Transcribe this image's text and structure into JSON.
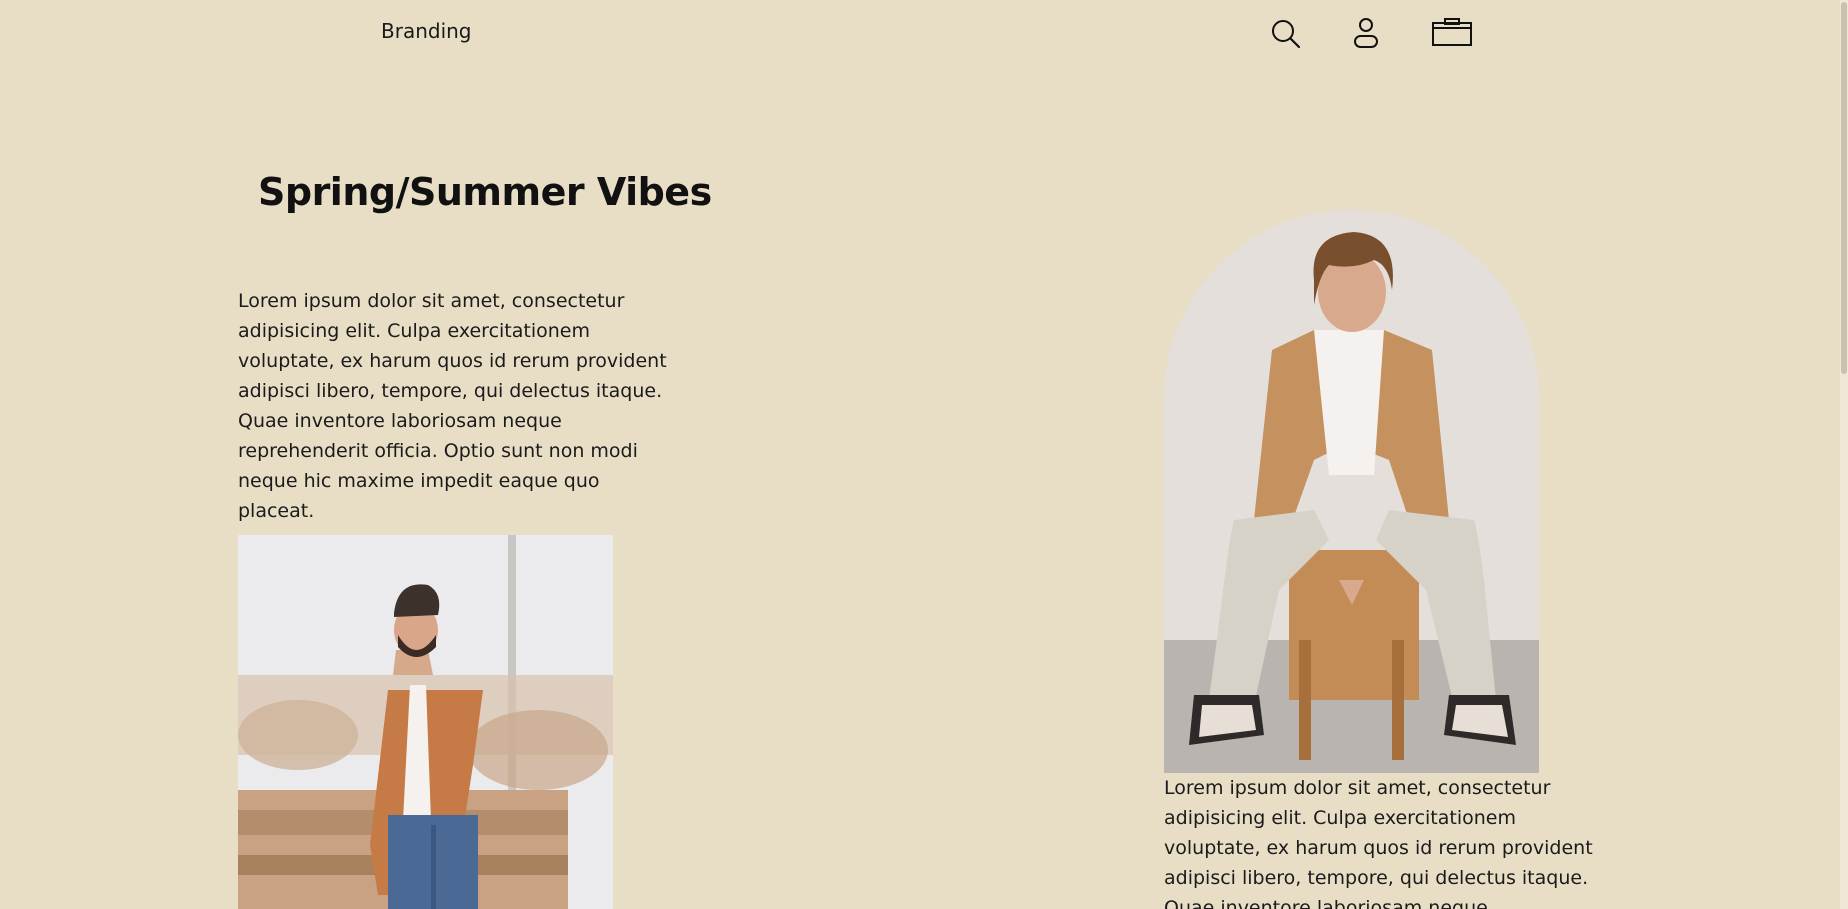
{
  "header": {
    "brand": "Branding",
    "icons": [
      "search-icon",
      "user-icon",
      "cart-icon"
    ]
  },
  "hero": {
    "title": "Spring/Summer Vibes",
    "paragraph_left": "Lorem ipsum dolor sit amet, consectetur adipisicing elit. Culpa exercitationem voluptate, ex harum quos id rerum provident adipisci libero, tempore, qui delectus itaque. Quae inventore laboriosam neque reprehenderit officia. Optio sunt non modi neque hic maxime impedit eaque quo placeat.",
    "paragraph_right": "Lorem ipsum dolor sit amet, consectetur adipisicing elit. Culpa exercitationem voluptate, ex harum quos id rerum provident adipisci libero, tempore, qui delectus itaque. Quae inventore laboriosam neque reprehenderit"
  },
  "colors": {
    "background": "#e8dec6",
    "text": "#111111",
    "jacket": "#c07a45"
  }
}
